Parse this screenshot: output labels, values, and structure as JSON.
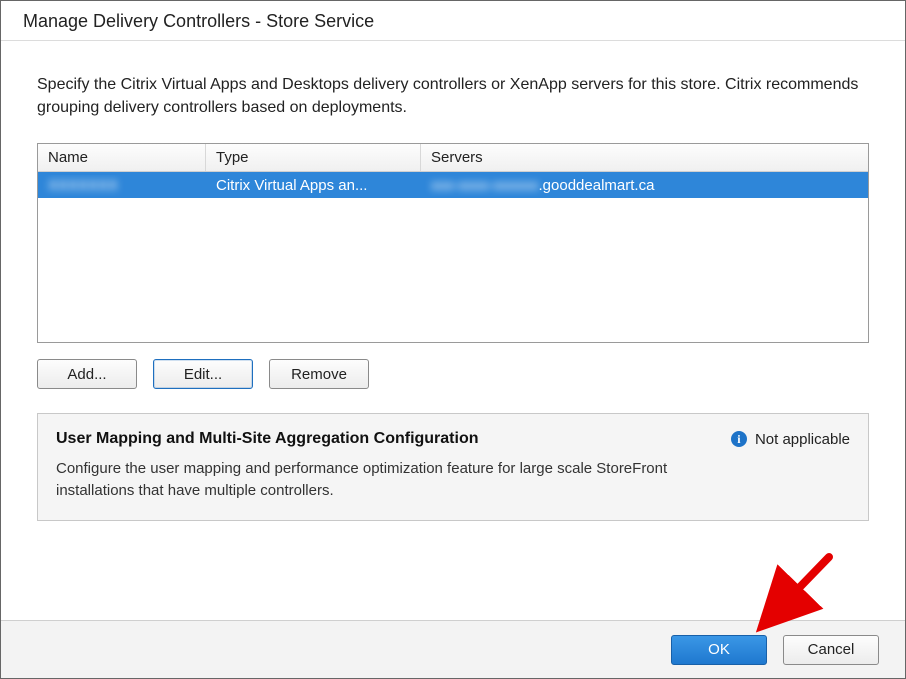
{
  "title": "Manage Delivery Controllers - Store Service",
  "intro": "Specify the Citrix Virtual Apps and Desktops delivery controllers or XenApp servers for this store. Citrix recommends grouping delivery controllers based on deployments.",
  "table": {
    "headers": {
      "name": "Name",
      "type": "Type",
      "servers": "Servers"
    },
    "rows": [
      {
        "name_masked": "XXXXXXX",
        "type": "Citrix Virtual Apps an...",
        "servers_masked_prefix": "xxx-xxxx-xxxxxx",
        "servers_suffix": ".gooddealmart.ca"
      }
    ]
  },
  "buttons": {
    "add": "Add...",
    "edit": "Edit...",
    "remove": "Remove"
  },
  "panel": {
    "title": "User Mapping and Multi-Site Aggregation Configuration",
    "status": "Not applicable",
    "desc": "Configure the user mapping and performance optimization feature for large scale StoreFront installations that have multiple controllers."
  },
  "footer": {
    "ok": "OK",
    "cancel": "Cancel"
  }
}
